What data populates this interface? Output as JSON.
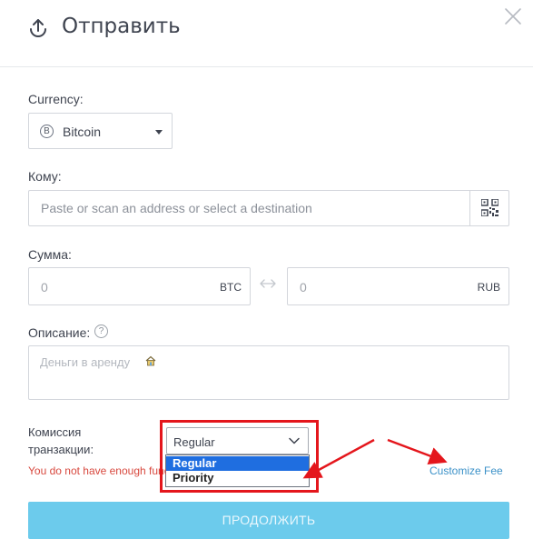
{
  "header": {
    "title": "Отправить",
    "icons": {
      "upload": "upload-icon",
      "close": "close-icon"
    }
  },
  "currency": {
    "label": "Currency:",
    "selected": "Bitcoin",
    "icon_glyph": "B"
  },
  "recipient": {
    "label": "Кому:",
    "placeholder": "Paste or scan an address or select a destination",
    "value": ""
  },
  "amount": {
    "label": "Сумма:",
    "crypto_value": "0",
    "crypto_unit": "BTC",
    "fiat_value": "0",
    "fiat_unit": "RUB"
  },
  "description": {
    "label": "Описание:",
    "help_glyph": "?",
    "placeholder": "Деньги в аренду"
  },
  "fee": {
    "label": "Комиссия транзакции:",
    "selected": "Regular",
    "options": [
      "Regular",
      "Priority"
    ],
    "error": "You do not have enough funds",
    "customize_label": "Customize Fee"
  },
  "continue_label": "ПРОДОЛЖИТЬ",
  "colors": {
    "accent": "#6ccbec",
    "link": "#3b91c8",
    "error": "#d8493f",
    "annotation": "#e4161c",
    "selected_option": "#1f6ee0"
  }
}
